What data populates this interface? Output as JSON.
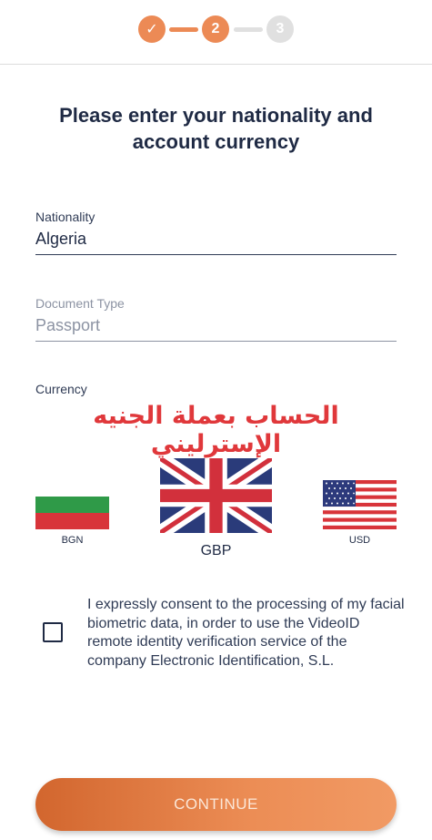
{
  "stepper": {
    "steps": [
      {
        "label": "✓",
        "state": "done"
      },
      {
        "label": "2",
        "state": "active"
      },
      {
        "label": "3",
        "state": "pending"
      }
    ]
  },
  "title": "Please enter your nationality and account currency",
  "nationality": {
    "label": "Nationality",
    "value": "Algeria"
  },
  "document_type": {
    "label": "Document Type",
    "value": "Passport"
  },
  "currency": {
    "label": "Currency",
    "annotation": "الحساب بعملة الجنيه الإسترليني",
    "options": [
      {
        "code": "BGN",
        "flag_icon": "bulgaria-flag-icon"
      },
      {
        "code": "GBP",
        "flag_icon": "uk-flag-icon",
        "selected": true
      },
      {
        "code": "USD",
        "flag_icon": "usa-flag-icon"
      }
    ]
  },
  "consent": {
    "text": "I expressly consent to the processing of my facial biometric data, in order to use the VideoID remote identity verification service of the company Electronic Identification, S.L.",
    "checked": false
  },
  "continue_label": "CONTINUE",
  "colors": {
    "accent": "#ec8a55",
    "pending_step": "#e0e0e0",
    "text": "#1f2a44",
    "annotation": "#e0383b"
  }
}
